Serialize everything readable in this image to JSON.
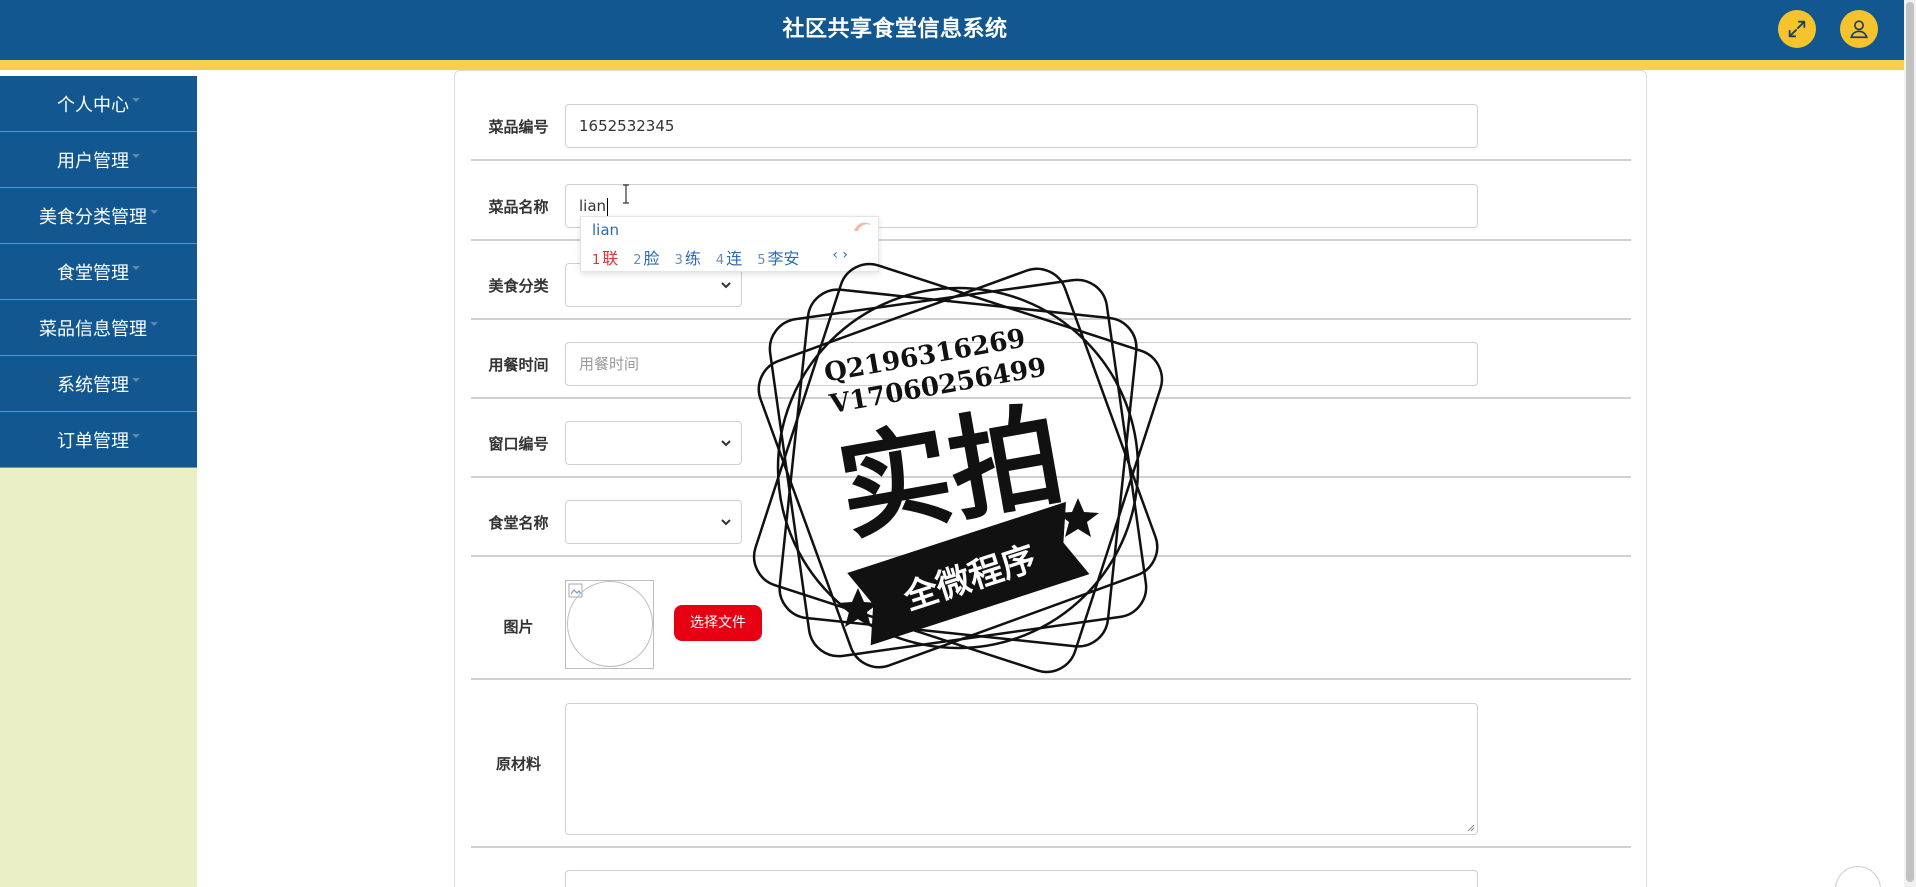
{
  "header": {
    "title": "社区共享食堂信息系统",
    "fullscreen_icon": "expand-arrows-icon",
    "user_icon": "user-icon",
    "bar_color": "#135790",
    "stripe_color": "#f6d04d",
    "button_color": "#f5c42c"
  },
  "sidebar": {
    "items": [
      {
        "label": "个人中心"
      },
      {
        "label": "用户管理"
      },
      {
        "label": "美食分类管理"
      },
      {
        "label": "食堂管理"
      },
      {
        "label": "菜品信息管理"
      },
      {
        "label": "系统管理"
      },
      {
        "label": "订单管理"
      }
    ]
  },
  "form": {
    "dish_no": {
      "label": "菜品编号",
      "value": "1652532345"
    },
    "dish_name": {
      "label": "菜品名称",
      "value": "lian"
    },
    "category": {
      "label": "美食分类",
      "value": ""
    },
    "meal_time": {
      "label": "用餐时间",
      "placeholder": "用餐时间"
    },
    "window_no": {
      "label": "窗口编号",
      "value": ""
    },
    "canteen_name": {
      "label": "食堂名称",
      "value": ""
    },
    "image": {
      "label": "图片",
      "button": "选择文件"
    },
    "ingredients": {
      "label": "原材料",
      "value": ""
    }
  },
  "ime": {
    "composition": "lian",
    "candidates": [
      {
        "num": "1",
        "text": "联"
      },
      {
        "num": "2",
        "text": "脸"
      },
      {
        "num": "3",
        "text": "练"
      },
      {
        "num": "4",
        "text": "连"
      },
      {
        "num": "5",
        "text": "李安"
      }
    ],
    "nav": "‹ ›"
  },
  "watermark": {
    "line1": "Q2196316269",
    "line2": "V17060256499",
    "big": "实拍",
    "banner": "全微程序"
  },
  "accent_red": "#e60012"
}
